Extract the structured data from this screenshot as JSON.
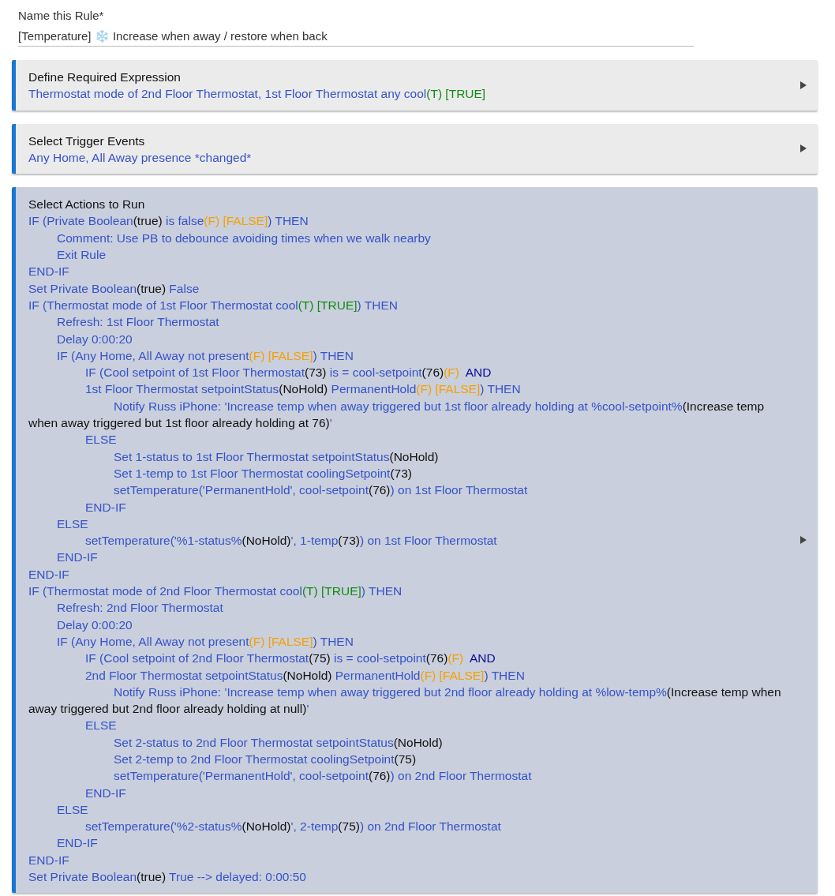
{
  "rule_name": {
    "label": "Name this Rule*",
    "value": "[Temperature] ❄️ Increase when away / restore when back"
  },
  "sections": [
    {
      "title": "Define Required Expression",
      "expanded": false,
      "lines": [
        {
          "segments": [
            {
              "kind": "text",
              "text": "Thermostat mode of 2nd Floor Thermostat, 1st Floor Thermostat any cool"
            },
            {
              "kind": "true",
              "text": "(T) [TRUE]"
            }
          ]
        }
      ]
    },
    {
      "title": "Select Trigger Events",
      "expanded": false,
      "lines": [
        {
          "segments": [
            {
              "kind": "text",
              "text": "Any Home, All Away presence *changed*"
            }
          ]
        }
      ]
    },
    {
      "title": "Select Actions to Run",
      "expanded": true,
      "lines": [
        {
          "segments": [
            {
              "kind": "text",
              "text": "IF (Private Boolean"
            },
            {
              "kind": "value",
              "text": "(true)"
            },
            {
              "kind": "text",
              "text": " is false"
            },
            {
              "kind": "false",
              "text": "(F) [FALSE]"
            },
            {
              "kind": "text",
              "text": ") THEN"
            }
          ],
          "children": [
            {
              "segments": [
                {
                  "kind": "text",
                  "text": "Comment: Use PB to debounce avoiding times when we walk nearby"
                }
              ]
            },
            {
              "segments": [
                {
                  "kind": "text",
                  "text": "Exit Rule"
                }
              ]
            }
          ]
        },
        {
          "segments": [
            {
              "kind": "text",
              "text": "END-IF"
            }
          ]
        },
        {
          "segments": [
            {
              "kind": "text",
              "text": "Set Private Boolean"
            },
            {
              "kind": "value",
              "text": "(true)"
            },
            {
              "kind": "text",
              "text": " False"
            }
          ]
        },
        {
          "segments": [
            {
              "kind": "text",
              "text": "IF (Thermostat mode of 1st Floor Thermostat cool"
            },
            {
              "kind": "true",
              "text": "(T) [TRUE]"
            },
            {
              "kind": "text",
              "text": ") THEN"
            }
          ],
          "children": [
            {
              "segments": [
                {
                  "kind": "text",
                  "text": "Refresh: 1st Floor Thermostat"
                }
              ]
            },
            {
              "segments": [
                {
                  "kind": "text",
                  "text": "Delay 0:00:20"
                }
              ]
            },
            {
              "segments": [
                {
                  "kind": "text",
                  "text": "IF (Any Home, All Away not present"
                },
                {
                  "kind": "false",
                  "text": "(F) [FALSE]"
                },
                {
                  "kind": "text",
                  "text": ") THEN"
                }
              ],
              "children": [
                {
                  "segments": [
                    {
                      "kind": "text",
                      "text": "IF (Cool setpoint of 1st Floor Thermostat"
                    },
                    {
                      "kind": "value",
                      "text": "(73)"
                    },
                    {
                      "kind": "text",
                      "text": " is = cool-setpoint"
                    },
                    {
                      "kind": "value",
                      "text": "(76)"
                    },
                    {
                      "kind": "false",
                      "text": "(F)"
                    },
                    {
                      "kind": "keyword",
                      "text": "  AND"
                    }
                  ]
                },
                {
                  "segments": [
                    {
                      "kind": "text",
                      "text": "1st Floor Thermostat setpointStatus"
                    },
                    {
                      "kind": "value",
                      "text": "(NoHold)"
                    },
                    {
                      "kind": "text",
                      "text": " PermanentHold"
                    },
                    {
                      "kind": "false",
                      "text": "(F) [FALSE]"
                    },
                    {
                      "kind": "text",
                      "text": ") THEN"
                    }
                  ],
                  "children": [
                    {
                      "segments": [
                        {
                          "kind": "text",
                          "text": "Notify Russ iPhone: 'Increase temp when away triggered but 1st floor already holding at %cool-setpoint%"
                        },
                        {
                          "kind": "value",
                          "text": "(Increase temp when away triggered but 1st floor already holding at 76)"
                        },
                        {
                          "kind": "text",
                          "text": "'"
                        }
                      ]
                    }
                  ]
                },
                {
                  "segments": [
                    {
                      "kind": "text",
                      "text": "ELSE"
                    }
                  ],
                  "children": [
                    {
                      "segments": [
                        {
                          "kind": "text",
                          "text": "Set 1-status to 1st Floor Thermostat setpointStatus"
                        },
                        {
                          "kind": "value",
                          "text": "(NoHold)"
                        }
                      ]
                    },
                    {
                      "segments": [
                        {
                          "kind": "text",
                          "text": "Set 1-temp to 1st Floor Thermostat coolingSetpoint"
                        },
                        {
                          "kind": "value",
                          "text": "(73)"
                        }
                      ]
                    },
                    {
                      "segments": [
                        {
                          "kind": "text",
                          "text": "setTemperature('PermanentHold', cool-setpoint"
                        },
                        {
                          "kind": "value",
                          "text": "(76)"
                        },
                        {
                          "kind": "text",
                          "text": ") on 1st Floor Thermostat"
                        }
                      ]
                    }
                  ]
                },
                {
                  "segments": [
                    {
                      "kind": "text",
                      "text": "END-IF"
                    }
                  ]
                }
              ]
            },
            {
              "segments": [
                {
                  "kind": "text",
                  "text": "ELSE"
                }
              ],
              "children": [
                {
                  "segments": [
                    {
                      "kind": "text",
                      "text": "setTemperature('%1-status%"
                    },
                    {
                      "kind": "value",
                      "text": "(NoHold)"
                    },
                    {
                      "kind": "text",
                      "text": "', 1-temp"
                    },
                    {
                      "kind": "value",
                      "text": "(73)"
                    },
                    {
                      "kind": "text",
                      "text": ") on 1st Floor Thermostat"
                    }
                  ]
                }
              ]
            },
            {
              "segments": [
                {
                  "kind": "text",
                  "text": "END-IF"
                }
              ]
            }
          ]
        },
        {
          "segments": [
            {
              "kind": "text",
              "text": "END-IF"
            }
          ]
        },
        {
          "segments": [
            {
              "kind": "text",
              "text": "IF (Thermostat mode of 2nd Floor Thermostat cool"
            },
            {
              "kind": "true",
              "text": "(T) [TRUE]"
            },
            {
              "kind": "text",
              "text": ") THEN"
            }
          ],
          "children": [
            {
              "segments": [
                {
                  "kind": "text",
                  "text": "Refresh: 2nd Floor Thermostat"
                }
              ]
            },
            {
              "segments": [
                {
                  "kind": "text",
                  "text": "Delay 0:00:20"
                }
              ]
            },
            {
              "segments": [
                {
                  "kind": "text",
                  "text": "IF (Any Home, All Away not present"
                },
                {
                  "kind": "false",
                  "text": "(F) [FALSE]"
                },
                {
                  "kind": "text",
                  "text": ") THEN"
                }
              ],
              "children": [
                {
                  "segments": [
                    {
                      "kind": "text",
                      "text": "IF (Cool setpoint of 2nd Floor Thermostat"
                    },
                    {
                      "kind": "value",
                      "text": "(75)"
                    },
                    {
                      "kind": "text",
                      "text": " is = cool-setpoint"
                    },
                    {
                      "kind": "value",
                      "text": "(76)"
                    },
                    {
                      "kind": "false",
                      "text": "(F)"
                    },
                    {
                      "kind": "keyword",
                      "text": "  AND"
                    }
                  ]
                },
                {
                  "segments": [
                    {
                      "kind": "text",
                      "text": "2nd Floor Thermostat setpointStatus"
                    },
                    {
                      "kind": "value",
                      "text": "(NoHold)"
                    },
                    {
                      "kind": "text",
                      "text": " PermanentHold"
                    },
                    {
                      "kind": "false",
                      "text": "(F) [FALSE]"
                    },
                    {
                      "kind": "text",
                      "text": ") THEN"
                    }
                  ],
                  "children": [
                    {
                      "segments": [
                        {
                          "kind": "text",
                          "text": "Notify Russ iPhone: 'Increase temp when away triggered but 2nd floor already holding at %low-temp%"
                        },
                        {
                          "kind": "value",
                          "text": "(Increase temp when away triggered but 2nd floor already holding at null)"
                        },
                        {
                          "kind": "text",
                          "text": "'"
                        }
                      ]
                    }
                  ]
                },
                {
                  "segments": [
                    {
                      "kind": "text",
                      "text": "ELSE"
                    }
                  ],
                  "children": [
                    {
                      "segments": [
                        {
                          "kind": "text",
                          "text": "Set 2-status to 2nd Floor Thermostat setpointStatus"
                        },
                        {
                          "kind": "value",
                          "text": "(NoHold)"
                        }
                      ]
                    },
                    {
                      "segments": [
                        {
                          "kind": "text",
                          "text": "Set 2-temp to 2nd Floor Thermostat coolingSetpoint"
                        },
                        {
                          "kind": "value",
                          "text": "(75)"
                        }
                      ]
                    },
                    {
                      "segments": [
                        {
                          "kind": "text",
                          "text": "setTemperature('PermanentHold', cool-setpoint"
                        },
                        {
                          "kind": "value",
                          "text": "(76)"
                        },
                        {
                          "kind": "text",
                          "text": ") on 2nd Floor Thermostat"
                        }
                      ]
                    }
                  ]
                },
                {
                  "segments": [
                    {
                      "kind": "text",
                      "text": "END-IF"
                    }
                  ]
                }
              ]
            },
            {
              "segments": [
                {
                  "kind": "text",
                  "text": "ELSE"
                }
              ],
              "children": [
                {
                  "segments": [
                    {
                      "kind": "text",
                      "text": "setTemperature('%2-status%"
                    },
                    {
                      "kind": "value",
                      "text": "(NoHold)"
                    },
                    {
                      "kind": "text",
                      "text": "', 2-temp"
                    },
                    {
                      "kind": "value",
                      "text": "(75)"
                    },
                    {
                      "kind": "text",
                      "text": ") on 2nd Floor Thermostat"
                    }
                  ]
                }
              ]
            },
            {
              "segments": [
                {
                  "kind": "text",
                  "text": "END-IF"
                }
              ]
            }
          ]
        },
        {
          "segments": [
            {
              "kind": "text",
              "text": "END-IF"
            }
          ]
        },
        {
          "segments": [
            {
              "kind": "text",
              "text": "Set Private Boolean"
            },
            {
              "kind": "value",
              "text": "(true)"
            },
            {
              "kind": "text",
              "text": " True --> delayed: 0:00:50"
            }
          ]
        }
      ]
    }
  ]
}
